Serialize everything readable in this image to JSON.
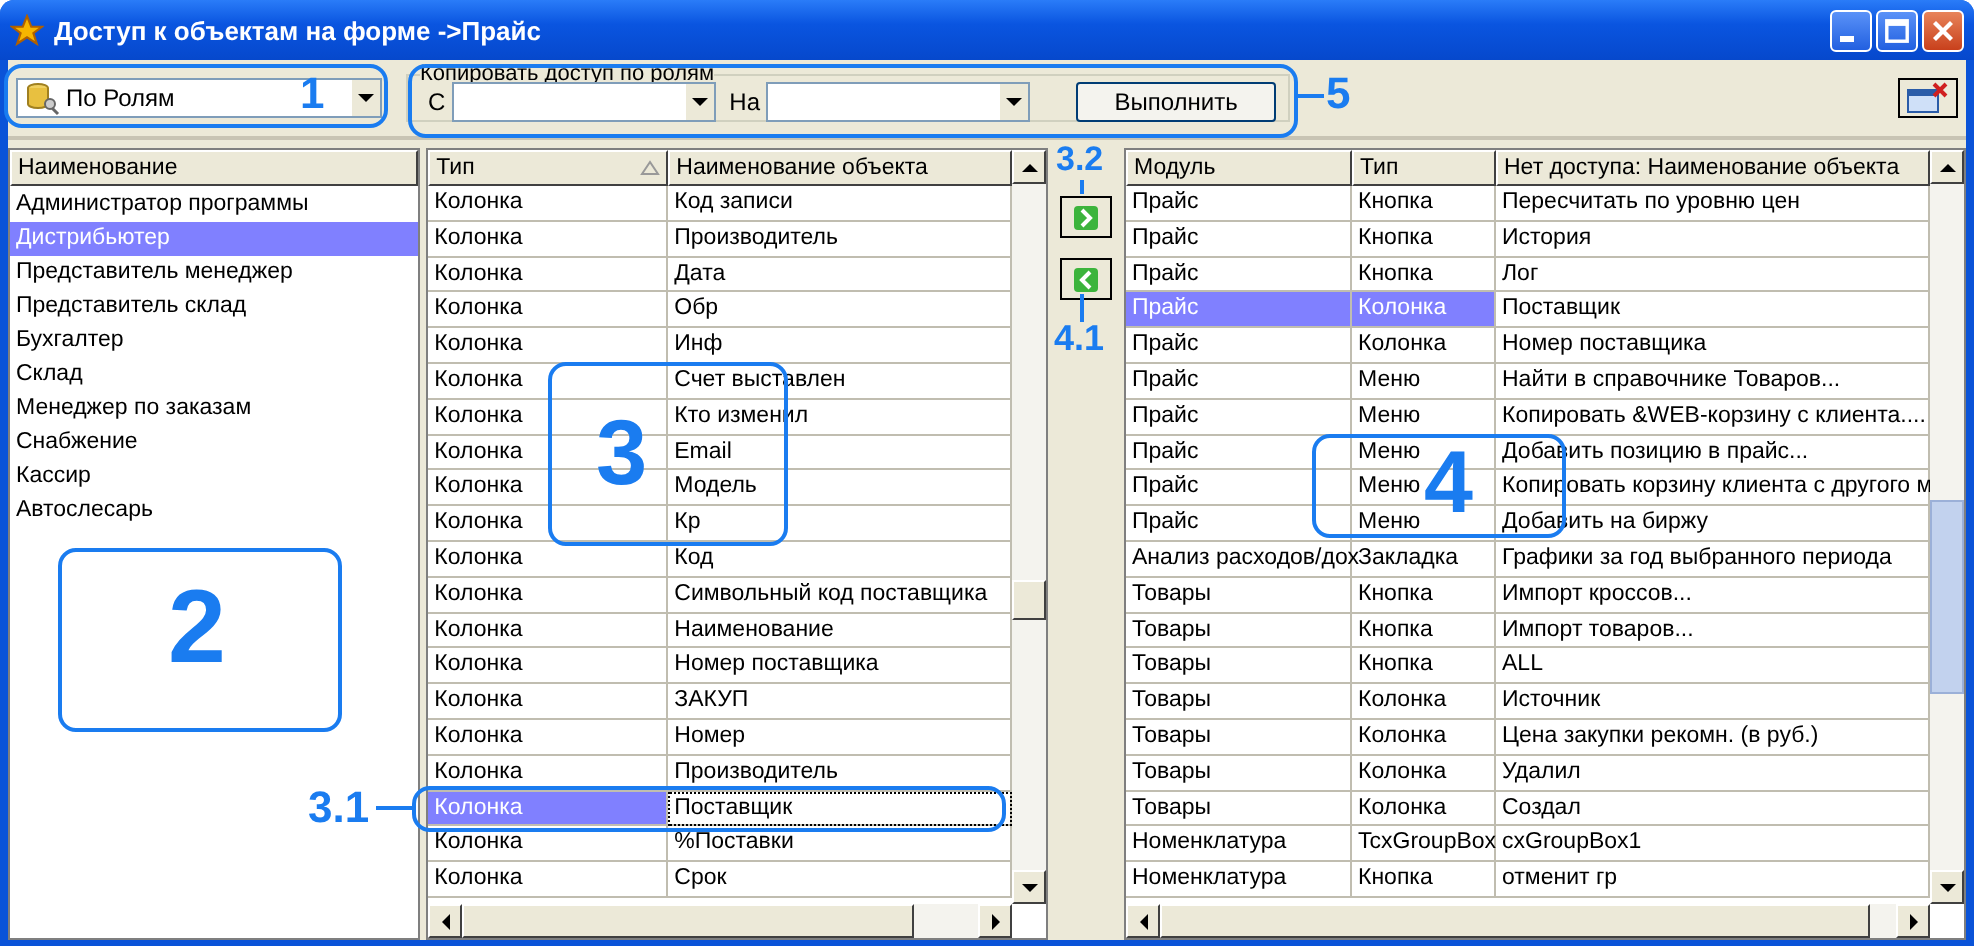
{
  "window": {
    "title": "Доступ к объектам на форме ->Прайс"
  },
  "view_mode": {
    "value": "По Ролям"
  },
  "copy_access": {
    "title": "Копировать доступ по ролям",
    "from_label": "С",
    "to_label": "На",
    "run_button": "Выполнить"
  },
  "roles": {
    "column": "Наименование",
    "items": [
      {
        "name": "Администратор программы",
        "selected": false
      },
      {
        "name": "Дистрибьютер",
        "selected": true
      },
      {
        "name": "Представитель менеджер",
        "selected": false
      },
      {
        "name": "Представитель склад",
        "selected": false
      },
      {
        "name": "Бухгалтер",
        "selected": false
      },
      {
        "name": "Склад",
        "selected": false
      },
      {
        "name": "Менеджер по заказам",
        "selected": false
      },
      {
        "name": "Снабжение",
        "selected": false
      },
      {
        "name": "Кассир",
        "selected": false
      },
      {
        "name": "Автослесарь",
        "selected": false
      }
    ]
  },
  "objects": {
    "columns": [
      "Тип",
      "Наименование объекта"
    ],
    "rows": [
      {
        "type": "Колонка",
        "name": "Код записи",
        "selected": false
      },
      {
        "type": "Колонка",
        "name": "Производитель",
        "selected": false
      },
      {
        "type": "Колонка",
        "name": "Дата",
        "selected": false
      },
      {
        "type": "Колонка",
        "name": "Обр",
        "selected": false
      },
      {
        "type": "Колонка",
        "name": "Инф",
        "selected": false
      },
      {
        "type": "Колонка",
        "name": "Счет выставлен",
        "selected": false
      },
      {
        "type": "Колонка",
        "name": "Кто изменил",
        "selected": false
      },
      {
        "type": "Колонка",
        "name": "Email",
        "selected": false
      },
      {
        "type": "Колонка",
        "name": "Модель",
        "selected": false
      },
      {
        "type": "Колонка",
        "name": "Кр",
        "selected": false
      },
      {
        "type": "Колонка",
        "name": "Код",
        "selected": false
      },
      {
        "type": "Колонка",
        "name": "Символьный код поставщика",
        "selected": false
      },
      {
        "type": "Колонка",
        "name": "Наименование",
        "selected": false
      },
      {
        "type": "Колонка",
        "name": "Номер поставщика",
        "selected": false
      },
      {
        "type": "Колонка",
        "name": "ЗАКУП",
        "selected": false
      },
      {
        "type": "Колонка",
        "name": "Номер",
        "selected": false
      },
      {
        "type": "Колонка",
        "name": "Производитель",
        "selected": false
      },
      {
        "type": "Колонка",
        "name": "Поставщик",
        "selected": true
      },
      {
        "type": "Колонка",
        "name": "%Поставки",
        "selected": false
      },
      {
        "type": "Колонка",
        "name": "Срок",
        "selected": false
      }
    ]
  },
  "denied": {
    "columns": [
      "Модуль",
      "Тип",
      "Нет доступа: Наименование объекта"
    ],
    "rows": [
      {
        "module": "Прайс",
        "type": "Кнопка",
        "name": "Пересчитать по уровню цен",
        "selected": false
      },
      {
        "module": "Прайс",
        "type": "Кнопка",
        "name": "История",
        "selected": false
      },
      {
        "module": "Прайс",
        "type": "Кнопка",
        "name": "Лог",
        "selected": false
      },
      {
        "module": "Прайс",
        "type": "Колонка",
        "name": "Поставщик",
        "selected": true
      },
      {
        "module": "Прайс",
        "type": "Колонка",
        "name": "Номер поставщика",
        "selected": false
      },
      {
        "module": "Прайс",
        "type": "Меню",
        "name": "Найти в справочнике Товаров...",
        "selected": false
      },
      {
        "module": "Прайс",
        "type": "Меню",
        "name": "Копировать &WEB-корзину с клиента....",
        "selected": false
      },
      {
        "module": "Прайс",
        "type": "Меню",
        "name": "Добавить позицию в прайс...",
        "selected": false
      },
      {
        "module": "Прайс",
        "type": "Меню",
        "name": "Копировать корзину клиента с другого м",
        "selected": false
      },
      {
        "module": "Прайс",
        "type": "Меню",
        "name": "Добавить на биржу",
        "selected": false
      },
      {
        "module": "Анализ расходов/дох",
        "type": "Закладка",
        "name": "Графики за год выбранного периода",
        "selected": false
      },
      {
        "module": "Товары",
        "type": "Кнопка",
        "name": "Импорт кроссов...",
        "selected": false
      },
      {
        "module": "Товары",
        "type": "Кнопка",
        "name": "Импорт товаров...",
        "selected": false
      },
      {
        "module": "Товары",
        "type": "Кнопка",
        "name": "ALL",
        "selected": false
      },
      {
        "module": "Товары",
        "type": "Колонка",
        "name": "Источник",
        "selected": false
      },
      {
        "module": "Товары",
        "type": "Колонка",
        "name": "Цена закупки рекомн. (в руб.)",
        "selected": false
      },
      {
        "module": "Товары",
        "type": "Колонка",
        "name": "Удалил",
        "selected": false
      },
      {
        "module": "Товары",
        "type": "Колонка",
        "name": "Создал",
        "selected": false
      },
      {
        "module": "Номенклатура",
        "type": "TcxGroupBox",
        "name": "cxGroupBox1",
        "selected": false
      },
      {
        "module": "Номенклатура",
        "type": "Кнопка",
        "name": "отменит гр",
        "selected": false
      }
    ]
  },
  "callouts": [
    {
      "label": "1"
    },
    {
      "label": "2"
    },
    {
      "label": "3"
    },
    {
      "label": "3.1"
    },
    {
      "label": "3.2"
    },
    {
      "label": "4"
    },
    {
      "label": "4.1"
    },
    {
      "label": "5"
    }
  ]
}
